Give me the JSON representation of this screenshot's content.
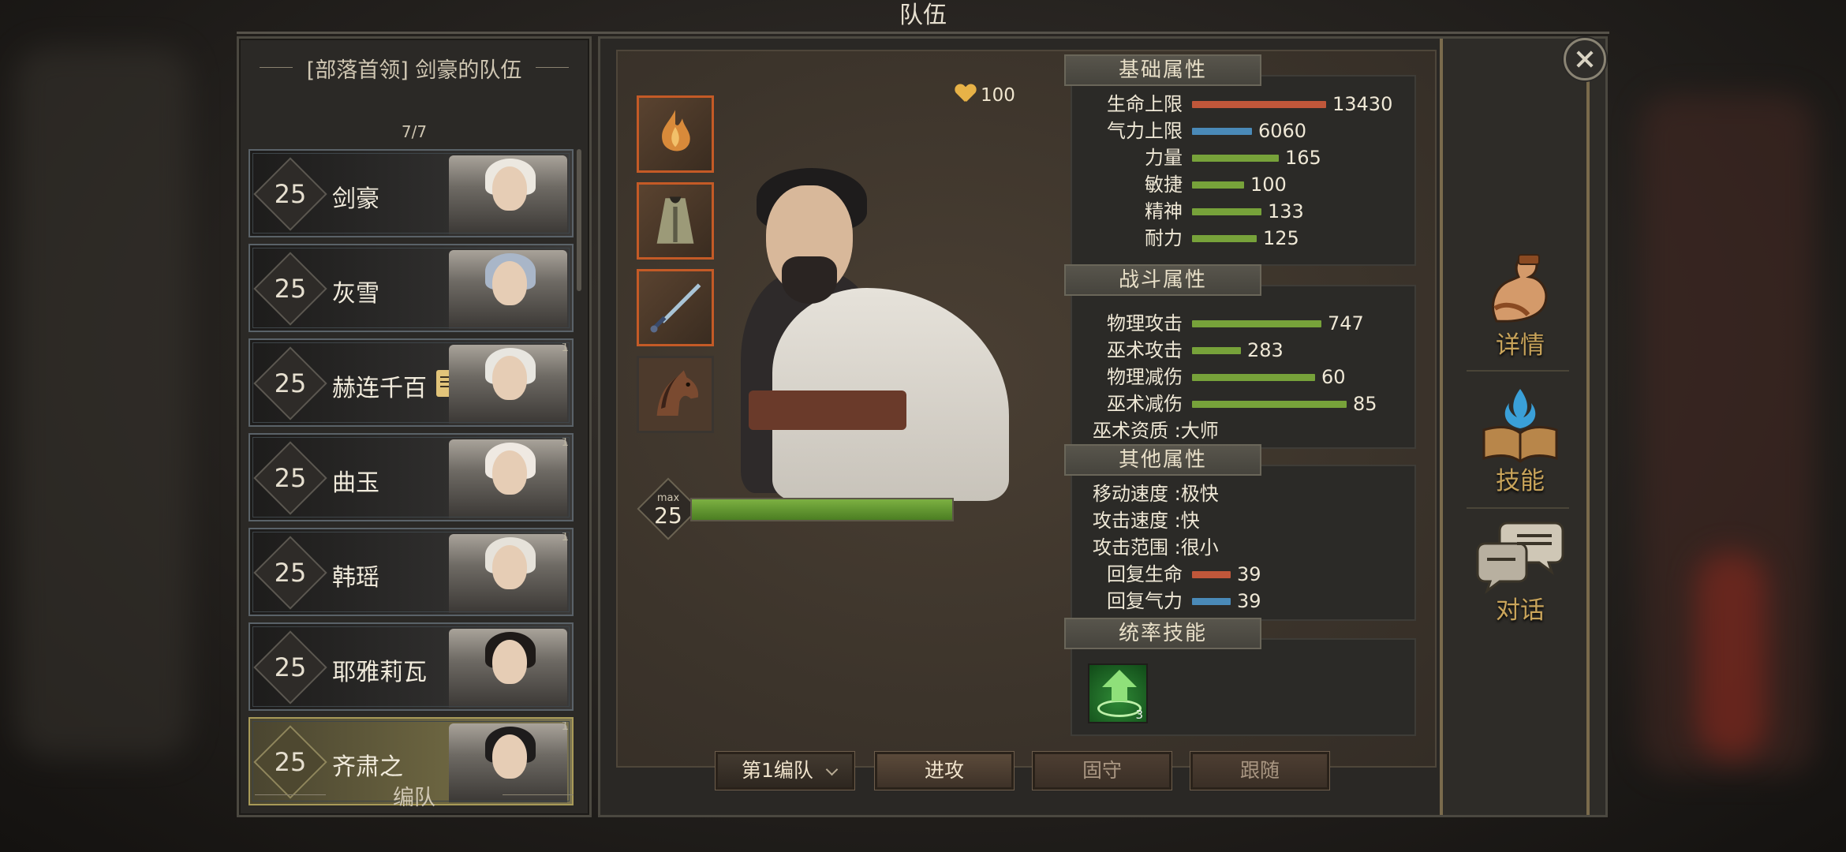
{
  "window": {
    "title": "队伍"
  },
  "team": {
    "title": "[部落首领] 剑豪的队伍",
    "count": "7/7",
    "formation_label": "编队",
    "members": [
      {
        "level": "25",
        "name": "剑豪",
        "corner": "",
        "note": false,
        "selected": false
      },
      {
        "level": "25",
        "name": "灰雪",
        "corner": "",
        "note": false,
        "selected": false
      },
      {
        "level": "25",
        "name": "赫连千百",
        "corner": "1",
        "note": true,
        "selected": false
      },
      {
        "level": "25",
        "name": "曲玉",
        "corner": "1",
        "note": false,
        "selected": false
      },
      {
        "level": "25",
        "name": "韩瑶",
        "corner": "1",
        "note": false,
        "selected": false
      },
      {
        "level": "25",
        "name": "耶雅莉瓦",
        "corner": "",
        "note": false,
        "selected": false
      },
      {
        "level": "25",
        "name": "齐肃之",
        "corner": "1",
        "note": false,
        "selected": true
      }
    ]
  },
  "character": {
    "affinity": "100",
    "level_max_label": "max",
    "level": "25",
    "exp_fraction": 1.0,
    "equipment": [
      {
        "slot": "accessory",
        "icon": "flame-amulet-icon"
      },
      {
        "slot": "armor",
        "icon": "robe-icon"
      },
      {
        "slot": "weapon",
        "icon": "sword-icon"
      },
      {
        "slot": "mount",
        "icon": "horse-icon"
      }
    ]
  },
  "attributes": {
    "basic": {
      "title": "基础属性",
      "rows": [
        {
          "label": "生命上限",
          "value": "13430",
          "bar": "red",
          "fraction": 0.85
        },
        {
          "label": "气力上限",
          "value": "6060",
          "bar": "blue",
          "fraction": 0.38
        },
        {
          "label": "力量",
          "value": "165",
          "bar": "green",
          "fraction": 0.55
        },
        {
          "label": "敏捷",
          "value": "100",
          "bar": "green",
          "fraction": 0.33
        },
        {
          "label": "精神",
          "value": "133",
          "bar": "green",
          "fraction": 0.44
        },
        {
          "label": "耐力",
          "value": "125",
          "bar": "green",
          "fraction": 0.41
        }
      ]
    },
    "combat": {
      "title": "战斗属性",
      "rows": [
        {
          "label": "物理攻击",
          "value": "747",
          "bar": "green",
          "fraction": 0.82
        },
        {
          "label": "巫术攻击",
          "value": "283",
          "bar": "green",
          "fraction": 0.31
        },
        {
          "label": "物理减伤",
          "value": "60",
          "bar": "green",
          "fraction": 0.78
        },
        {
          "label": "巫术减伤",
          "value": "85",
          "bar": "green",
          "fraction": 0.98
        }
      ],
      "aptitude": "巫术资质 :大师"
    },
    "other": {
      "title": "其他属性",
      "texts": [
        "移动速度 :极快",
        "攻击速度 :快",
        "攻击范围 :很小"
      ],
      "rows": [
        {
          "label": "回复生命",
          "value": "39",
          "bar": "red",
          "fraction": 0.35
        },
        {
          "label": "回复气力",
          "value": "39",
          "bar": "blue",
          "fraction": 0.35
        }
      ]
    },
    "leadership": {
      "title": "统率技能",
      "skill_icon": "heal-up-icon",
      "skill_count": "3"
    }
  },
  "actions": {
    "formation_select": "第1编队",
    "attack": "进攻",
    "defend": "固守",
    "follow": "跟随"
  },
  "tabs": [
    {
      "label": "详情",
      "icon": "muscle-arm-icon"
    },
    {
      "label": "技能",
      "icon": "flaming-book-icon"
    },
    {
      "label": "对话",
      "icon": "speech-bubbles-icon"
    }
  ],
  "colors": {
    "accent_gold": "#c9a45a",
    "hp_red": "#c0573a",
    "mp_blue": "#4a8ab8",
    "stat_green": "#77a23a",
    "equip_border": "#c45a26"
  }
}
